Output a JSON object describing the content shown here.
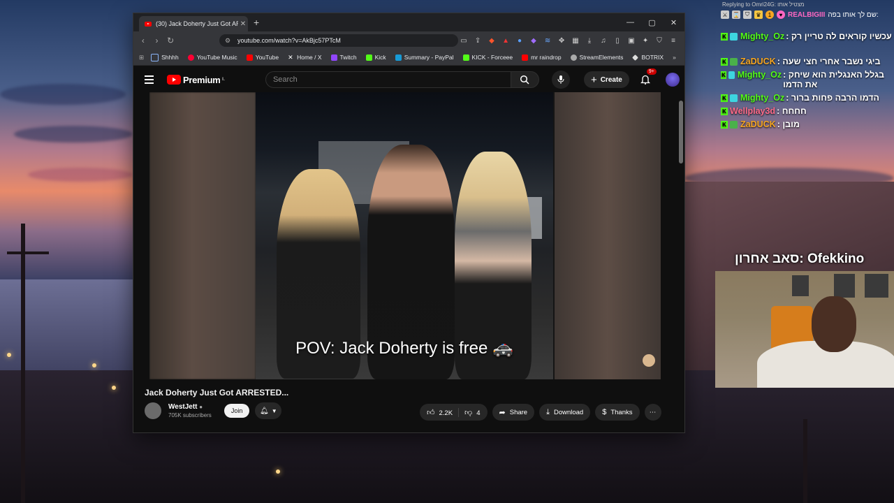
{
  "browser": {
    "tab_title": "(30) Jack Doherty Just Got ARRE",
    "tab_close": "✕",
    "new_tab": "+",
    "url": "youtube.com/watch?v=AkBjc57PTcM",
    "bookmarks": [
      {
        "label": "Shhhh",
        "color": "#8ab4f8"
      },
      {
        "label": "YouTube Music",
        "color": "#ff0033"
      },
      {
        "label": "YouTube",
        "color": "#ff0000"
      },
      {
        "label": "Home / X",
        "color": "#ffffff"
      },
      {
        "label": "Twitch",
        "color": "#9146ff"
      },
      {
        "label": "Kick",
        "color": "#53fc18"
      },
      {
        "label": "Summary - PayPal",
        "color": "#179bd7"
      },
      {
        "label": "KICK - Forceee",
        "color": "#53fc18"
      },
      {
        "label": "mr raindrop",
        "color": "#ff0000"
      },
      {
        "label": "StreamElements",
        "color": "#aaaaaa"
      },
      {
        "label": "BOTRIX",
        "color": "#dddddd"
      }
    ]
  },
  "youtube": {
    "logo_text": "Premium",
    "logo_region": "IL",
    "search_placeholder": "Search",
    "create_label": "Create",
    "notif_count": "9+",
    "caption": "POV: Jack Doherty is free 🚓",
    "video_title": "Jack Doherty Just Got ARRESTED...",
    "channel_name": "WestJett",
    "subscribers": "705K subscribers",
    "join_label": "Join",
    "likes": "2.2K",
    "dislikes": "4",
    "share_label": "Share",
    "download_label": "Download",
    "thanks_label": "Thanks"
  },
  "chat": {
    "reply_to": "Replying to Omri24G: מצטיל אותו",
    "pinned_user": "REALBIGIII",
    "pinned_text": "שם לך אותו בפה:",
    "pinned_count": "1",
    "messages": [
      {
        "user": "Mighty_Oz",
        "text": ": עכשיו קוראים לה טריין רק",
        "color": "#53fc18"
      },
      {
        "user": "ZaDUCK",
        "text": ": ביגי נשבר אחרי חצי שעה",
        "color": "#f5a623"
      },
      {
        "user": "Mighty_Oz",
        "text": ": בגלל האנגלית הוא שיחק את הדמו",
        "color": "#53fc18"
      },
      {
        "user": "Mighty_Oz",
        "text": ": הדמו הרבה פחות ברור",
        "color": "#53fc18"
      },
      {
        "user": "Wellplay3d",
        "text": ": חחחח",
        "color": "#ff6b8a"
      },
      {
        "user": "ZaDUCK",
        "text": ": מובן",
        "color": "#f5a623"
      }
    ]
  },
  "webcam_label": "סאב אחרון: Ofekkino"
}
